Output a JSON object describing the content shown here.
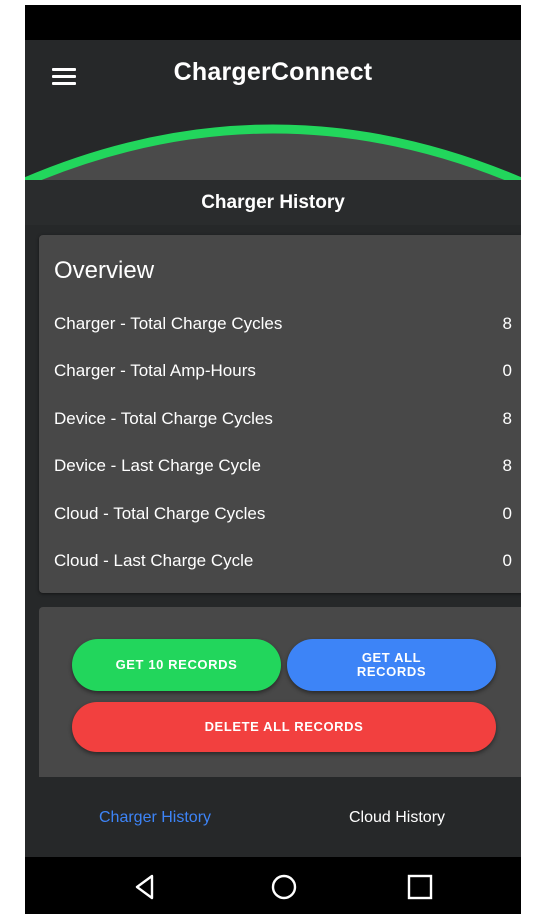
{
  "app": {
    "title": "ChargerConnect"
  },
  "colors": {
    "accent_green": "#22d65c",
    "accent_blue": "#3d84f7",
    "accent_red": "#f2403f",
    "background": "#262829",
    "card": "#484848"
  },
  "section": {
    "title": "Charger History"
  },
  "overview": {
    "title": "Overview",
    "rows": [
      {
        "label": "Charger - Total Charge Cycles",
        "value": "8"
      },
      {
        "label": "Charger - Total Amp-Hours",
        "value": "0"
      },
      {
        "label": "Device - Total Charge Cycles",
        "value": "8"
      },
      {
        "label": "Device - Last Charge Cycle",
        "value": "8"
      },
      {
        "label": "Cloud - Total Charge Cycles",
        "value": "0"
      },
      {
        "label": "Cloud - Last Charge Cycle",
        "value": "0"
      }
    ]
  },
  "actions": {
    "get_10": "GET 10 RECORDS",
    "get_all_line1": "GET ALL",
    "get_all_line2": "RECORDS",
    "delete_all": "DELETE ALL RECORDS"
  },
  "tabs": [
    {
      "label": "Charger History",
      "active": true
    },
    {
      "label": "Cloud History",
      "active": false
    }
  ],
  "icons": {
    "menu": "menu-icon",
    "back": "nav-back-icon",
    "home": "nav-home-icon",
    "recents": "nav-recents-icon"
  }
}
